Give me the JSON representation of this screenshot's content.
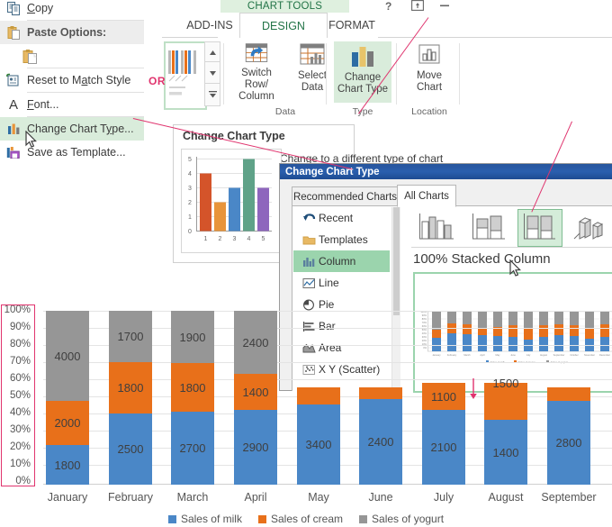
{
  "context_menu": {
    "items": [
      {
        "label": "Copy",
        "icon": "copy-icon",
        "highlighted": false
      },
      {
        "label": "Paste Options:",
        "icon": "paste-icon",
        "highlighted": false
      },
      {
        "label": "",
        "icon": "paste-keep-formatting-icon",
        "highlighted": false
      },
      {
        "label": "Reset to Match Style",
        "icon": "reset-style-icon",
        "highlighted": false
      },
      {
        "label": "Font...",
        "icon": "font-a-icon",
        "highlighted": false
      },
      {
        "label": "Change Chart Type...",
        "icon": "chart-type-icon",
        "highlighted": true
      },
      {
        "label": "Save as Template...",
        "icon": "save-template-icon",
        "highlighted": false
      }
    ]
  },
  "ribbon": {
    "contextual_title": "CHART TOOLS",
    "tabs": [
      {
        "label": "ADD-INS",
        "active": false
      },
      {
        "label": "DESIGN",
        "active": true
      },
      {
        "label": "FORMAT",
        "active": false
      }
    ],
    "groups": [
      {
        "label": "Data",
        "buttons": [
          {
            "label": "Switch Row/\nColumn",
            "line1": "Switch Row/",
            "line2": "Column",
            "icon": "switch-row-column-icon",
            "selected": false
          },
          {
            "label": "Select Data",
            "line1": "Select",
            "line2": "Data",
            "icon": "select-data-icon",
            "selected": false
          }
        ]
      },
      {
        "label": "Type",
        "buttons": [
          {
            "label": "Change Chart Type",
            "line1": "Change",
            "line2": "Chart Type",
            "icon": "change-chart-type-icon",
            "selected": true
          }
        ]
      },
      {
        "label": "Location",
        "buttons": [
          {
            "label": "Move Chart",
            "line1": "Move",
            "line2": "Chart",
            "icon": "move-chart-icon",
            "selected": false
          }
        ]
      }
    ],
    "window_controls": [
      {
        "name": "help-icon",
        "glyph": "?"
      },
      {
        "name": "ribbon-display-options-icon",
        "glyph": "⬆"
      },
      {
        "name": "minimize-icon",
        "glyph": "—"
      }
    ]
  },
  "tooltip": {
    "title": "Change Chart Type",
    "description": "Change to a different type of chart",
    "preview_axis": [
      "5",
      "4",
      "3",
      "2",
      "1",
      "0"
    ],
    "preview_categories": [
      "1",
      "2",
      "3",
      "4",
      "5"
    ],
    "preview_values": [
      4,
      2,
      3,
      5,
      3
    ],
    "preview_colors": [
      "#d4542a",
      "#e8943a",
      "#4a87c7",
      "#5fa288",
      "#8e66bd"
    ]
  },
  "dialog": {
    "title": "Change Chart Type",
    "tabs": [
      {
        "label": "Recommended Charts",
        "active": false
      },
      {
        "label": "All Charts",
        "active": true
      }
    ],
    "categories": [
      {
        "label": "Recent",
        "icon": "recent-icon",
        "selected": false
      },
      {
        "label": "Templates",
        "icon": "templates-folder-icon",
        "selected": false
      },
      {
        "label": "Column",
        "icon": "column-chart-icon",
        "selected": true
      },
      {
        "label": "Line",
        "icon": "line-chart-icon",
        "selected": false
      },
      {
        "label": "Pie",
        "icon": "pie-chart-icon",
        "selected": false
      },
      {
        "label": "Bar",
        "icon": "bar-chart-icon",
        "selected": false
      },
      {
        "label": "Area",
        "icon": "area-chart-icon",
        "selected": false
      },
      {
        "label": "X Y (Scatter)",
        "icon": "scatter-chart-icon",
        "selected": false
      }
    ],
    "type_thumbnails": [
      {
        "name": "clustered-column-thumb",
        "selected": false
      },
      {
        "name": "stacked-column-thumb",
        "selected": false
      },
      {
        "name": "100-stacked-column-thumb",
        "selected": true
      },
      {
        "name": "3d-clustered-column-thumb",
        "selected": false
      }
    ],
    "selected_type_name": "100% Stacked Column",
    "preview_legend": [
      "Sales of milk",
      "Sales of cream",
      "Sales of yogurt"
    ],
    "preview_months": [
      "January",
      "February",
      "March",
      "April",
      "May",
      "June",
      "July",
      "August",
      "September",
      "October",
      "November",
      "December"
    ]
  },
  "annotations": {
    "or_text": "OR"
  },
  "chart_data": {
    "type": "bar",
    "stacked": "100%",
    "title": "",
    "xlabel": "",
    "ylabel": "",
    "ylim": [
      0,
      100
    ],
    "grid": true,
    "legend_position": "bottom",
    "ytick_labels": [
      "100%",
      "90%",
      "80%",
      "70%",
      "60%",
      "50%",
      "40%",
      "30%",
      "20%",
      "10%",
      "0%"
    ],
    "categories": [
      "January",
      "February",
      "March",
      "April",
      "May",
      "June",
      "July",
      "August",
      "September"
    ],
    "series": [
      {
        "name": "Sales of milk",
        "color": "#4a87c7",
        "values": [
          1800,
          2500,
          2700,
          2900,
          3400,
          2400,
          2100,
          1400,
          2800
        ]
      },
      {
        "name": "Sales of cream",
        "color": "#e8701a",
        "values": [
          2000,
          1800,
          1800,
          1400,
          600,
          400,
          1100,
          1500,
          500
        ]
      },
      {
        "name": "Sales of yogurt",
        "color": "#969696",
        "values": [
          4000,
          1700,
          1900,
          2400,
          0,
          0,
          0,
          0,
          0
        ]
      }
    ],
    "visible_labels": [
      {
        "category": "January",
        "series": "Sales of milk",
        "value": "1800"
      },
      {
        "category": "January",
        "series": "Sales of cream",
        "value": "2000"
      },
      {
        "category": "January",
        "series": "Sales of yogurt",
        "value": "4000"
      },
      {
        "category": "February",
        "series": "Sales of milk",
        "value": "2500"
      },
      {
        "category": "February",
        "series": "Sales of cream",
        "value": "1800"
      },
      {
        "category": "February",
        "series": "Sales of yogurt",
        "value": "1700"
      },
      {
        "category": "March",
        "series": "Sales of milk",
        "value": "2700"
      },
      {
        "category": "March",
        "series": "Sales of cream",
        "value": "1800"
      },
      {
        "category": "March",
        "series": "Sales of yogurt",
        "value": "1900"
      },
      {
        "category": "April",
        "series": "Sales of milk",
        "value": "2900"
      },
      {
        "category": "April",
        "series": "Sales of cream",
        "value": "1400"
      },
      {
        "category": "April",
        "series": "Sales of yogurt",
        "value": "2400"
      },
      {
        "category": "May",
        "series": "Sales of milk",
        "value": "3400"
      },
      {
        "category": "June",
        "series": "Sales of milk",
        "value": "2400"
      },
      {
        "category": "July",
        "series": "Sales of milk",
        "value": "2100"
      },
      {
        "category": "July",
        "series": "Sales of cream",
        "value": "1100"
      },
      {
        "category": "August",
        "series": "Sales of milk",
        "value": "1400"
      },
      {
        "category": "August",
        "series": "Sales of cream",
        "value": "1500"
      },
      {
        "category": "September",
        "series": "Sales of milk",
        "value": "2800"
      }
    ]
  }
}
